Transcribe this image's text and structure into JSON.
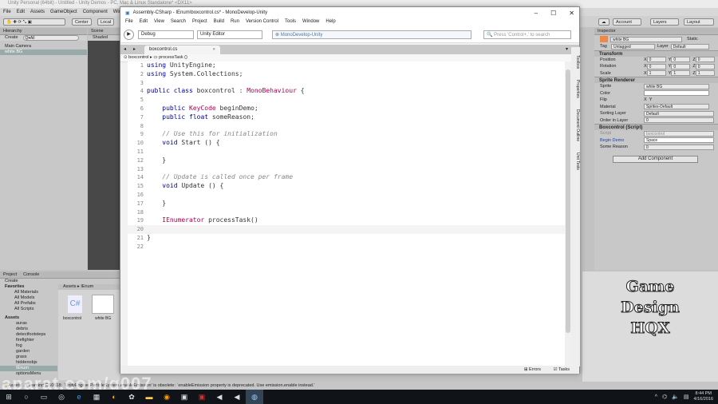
{
  "unity": {
    "title": "Unity Personal (64bit) - Untitled - Unity Demos - PC, Mac & Linux Standalone* <DX11>",
    "menu": [
      "File",
      "Edit",
      "Assets",
      "GameObject",
      "Component",
      "Window"
    ],
    "toolbar": {
      "center": "Center",
      "local": "Local",
      "account": "Account",
      "layers": "Layers",
      "layout": "Layout"
    },
    "hierarchy": {
      "title": "Hierarchy",
      "create": "Create",
      "search": "Q▾All",
      "items": [
        "Main Camera",
        "white BG"
      ]
    },
    "scene": {
      "title": "Scene",
      "shaded": "Shaded"
    },
    "inspector": {
      "title": "Inspector",
      "object": "white BG",
      "static": "Static",
      "tag_label": "Tag",
      "tag": "Untagged",
      "layer_label": "Layer",
      "layer": "Default",
      "transform": {
        "title": "Transform",
        "rows": [
          {
            "label": "Position",
            "x": "0",
            "y": "0",
            "z": "0"
          },
          {
            "label": "Rotation",
            "x": "0",
            "y": "0",
            "z": "0"
          },
          {
            "label": "Scale",
            "x": "1",
            "y": "1",
            "z": "1"
          }
        ]
      },
      "sprite_renderer": {
        "title": "Sprite Renderer",
        "sprite_label": "Sprite",
        "sprite": "white BG",
        "color_label": "Color",
        "flip_label": "Flip",
        "flip_x": "X",
        "flip_y": "Y",
        "material_label": "Material",
        "material": "Sprites-Default",
        "sorting_label": "Sorting Layer",
        "sorting": "Default",
        "order_label": "Order in Layer",
        "order": "0"
      },
      "script": {
        "title": "Boxcontrol (Script)",
        "script_label": "Script",
        "script": "boxcontrol",
        "begin_label": "Begin Demo",
        "begin": "Space",
        "reason_label": "Some Reason",
        "reason": "0"
      },
      "add_component": "Add Component"
    },
    "project": {
      "tabs": [
        "Project",
        "Console"
      ],
      "create": "Create",
      "favorites": [
        "Favorites",
        "All Materials",
        "All Models",
        "All Prefabs",
        "All Scripts"
      ],
      "assets_root": "Assets",
      "folders": [
        "auras",
        "debris",
        "detectfootsteps",
        "firefighter",
        "fog",
        "garden",
        "grass",
        "hiddenobjs",
        "IEnum",
        "optionsMenu"
      ],
      "breadcrumb": [
        "Assets",
        "IEnum"
      ],
      "files": [
        {
          "name": "boxcontrol",
          "icon": "C#"
        },
        {
          "name": "white BG"
        }
      ]
    },
    "status": "Assets/...: warning CS0618: `UnityEngine.ParticleSystem.enableEmission' is obsolete: `enableEmission property is deprecated. Use emission.enable instead.'",
    "logo": [
      "Game",
      "Design",
      "HQX"
    ]
  },
  "md": {
    "title": "Assembly-CSharp - IEnum\\boxcontrol.cs* - MonoDevelop-Unity",
    "menu": [
      "File",
      "Edit",
      "View",
      "Search",
      "Project",
      "Build",
      "Run",
      "Version Control",
      "Tools",
      "Window",
      "Help"
    ],
    "config": "Debug",
    "target": "Unity Editor",
    "status": "MonoDevelop-Unity",
    "search_placeholder": "Press 'Control+,' to search",
    "tab": "boxcontrol.cs",
    "breadcrumb": [
      "boxcontrol",
      "processTask ()"
    ],
    "side_tabs": [
      "Toolbox",
      "Properties",
      "Document Outline",
      "Unit Tests"
    ],
    "bottom": {
      "errors": "Errors",
      "tasks": "Tasks"
    },
    "lines": [
      "using UnityEngine;",
      "using System.Collections;",
      "",
      "public class boxcontrol : MonoBehaviour {",
      "",
      "    public KeyCode beginDemo;",
      "    public float someReason;",
      "",
      "    // Use this for initialization",
      "    void Start () {",
      "",
      "    }",
      "",
      "    // Update is called once per frame",
      "    void Update () {",
      "",
      "    }",
      "",
      "    IEnumerator processTask()",
      "",
      "}",
      ""
    ]
  },
  "taskbar": {
    "time": "8:44 PM",
    "date": "4/16/2016"
  },
  "watermark": "aparat.com/g007"
}
